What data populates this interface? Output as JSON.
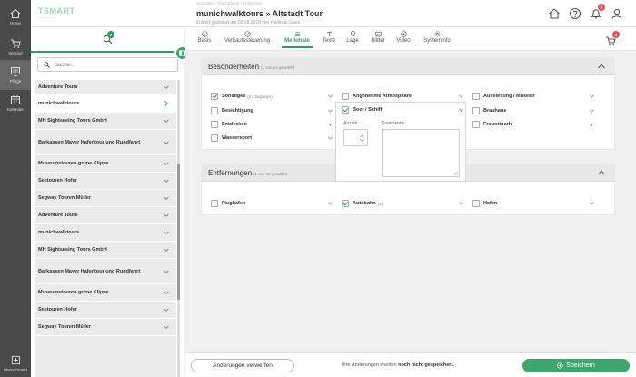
{
  "rail": {
    "items": [
      {
        "label": "Home",
        "icon": "house-icon"
      },
      {
        "label": "Verkauf",
        "icon": "cart-icon"
      },
      {
        "label": "Pflege",
        "icon": "monitor-icon"
      },
      {
        "label": "Kalender",
        "icon": "calendar-icon"
      }
    ],
    "new_label": "Neues Fenster"
  },
  "header": {
    "logo": "TSMART",
    "logo_sub": "—————",
    "breadcrumb": "Startseite  ›  Touchpflege  ›  Erlebnisse",
    "title": "munichwalktours » Altstadt Tour",
    "changed": "Zuletzt geändert am 02.08.2018 von Gerlinde Gans.",
    "bell_badge": "3",
    "cart_badge": "3"
  },
  "sidebar": {
    "search_badge": "7",
    "search_placeholder": "Suche...",
    "items": [
      "Adventure Tours",
      "munichwalktours",
      "MH Sightseeing Tours GmbH",
      "Barkassen Mayer Hafentour und Rundfahrt",
      "Museumstouren grüne Klippe",
      "Seetouren Hofer",
      "Segway Touren Müller",
      "Adventure Tours",
      "munichwalktours",
      "MH Sightseeing Tours GmbH",
      "Barkassen Mayer Hafentour und Rundfahrt",
      "Museumstouren grüne Klippe",
      "Seetouren Hofer",
      "Segway Touren Müller"
    ]
  },
  "tabs": [
    "Basis",
    "Verkaufssteuerung",
    "Merkmale",
    "Texte",
    "Lage",
    "Bilder",
    "Video",
    "Systeminfo"
  ],
  "tabs_active": "Merkmale",
  "besonderheiten": {
    "title": "Besonderheiten",
    "count": "(1 von 24 gewählt)",
    "features": [
      {
        "label": "Sonstiges",
        "note": "(4 / Segways)",
        "checked": true
      },
      {
        "label": "Besichtigung",
        "note": "",
        "checked": false
      },
      {
        "label": "Entdecken",
        "note": "",
        "checked": false
      },
      {
        "label": "Wassersport",
        "note": "",
        "checked": false
      },
      {
        "label": "Angenehme Atmosphäre",
        "note": "",
        "checked": false
      },
      {
        "label": "Boot / Schiff",
        "note": "",
        "checked": true
      },
      {
        "label": "Ausstellung / Museen",
        "note": "",
        "checked": false
      },
      {
        "label": "Brauhaus",
        "note": "",
        "checked": false
      },
      {
        "label": "Freizeitpark",
        "note": "",
        "checked": false
      }
    ]
  },
  "popup": {
    "anzahl_label": "Anzahl",
    "kommentar_label": "Kommentar"
  },
  "entfernungen": {
    "title": "Entfernungen",
    "count": "(1 von 12 gewählt)",
    "features": [
      {
        "label": "Flughafen",
        "note": "",
        "checked": false
      },
      {
        "label": "Autobahn",
        "note": "(5)",
        "checked": true
      },
      {
        "label": "Hafen",
        "note": "",
        "checked": false
      }
    ]
  },
  "footer": {
    "discard": "Änderungen verwerfen",
    "unsaved_pre": "Ihre Änderungen wurden",
    "unsaved_bold": "noch nicht gespeichert.",
    "save": "Speichern"
  },
  "colors": {
    "accent": "#2f9e63",
    "rail": "#4a4a4a",
    "badge": "#e8505b"
  }
}
